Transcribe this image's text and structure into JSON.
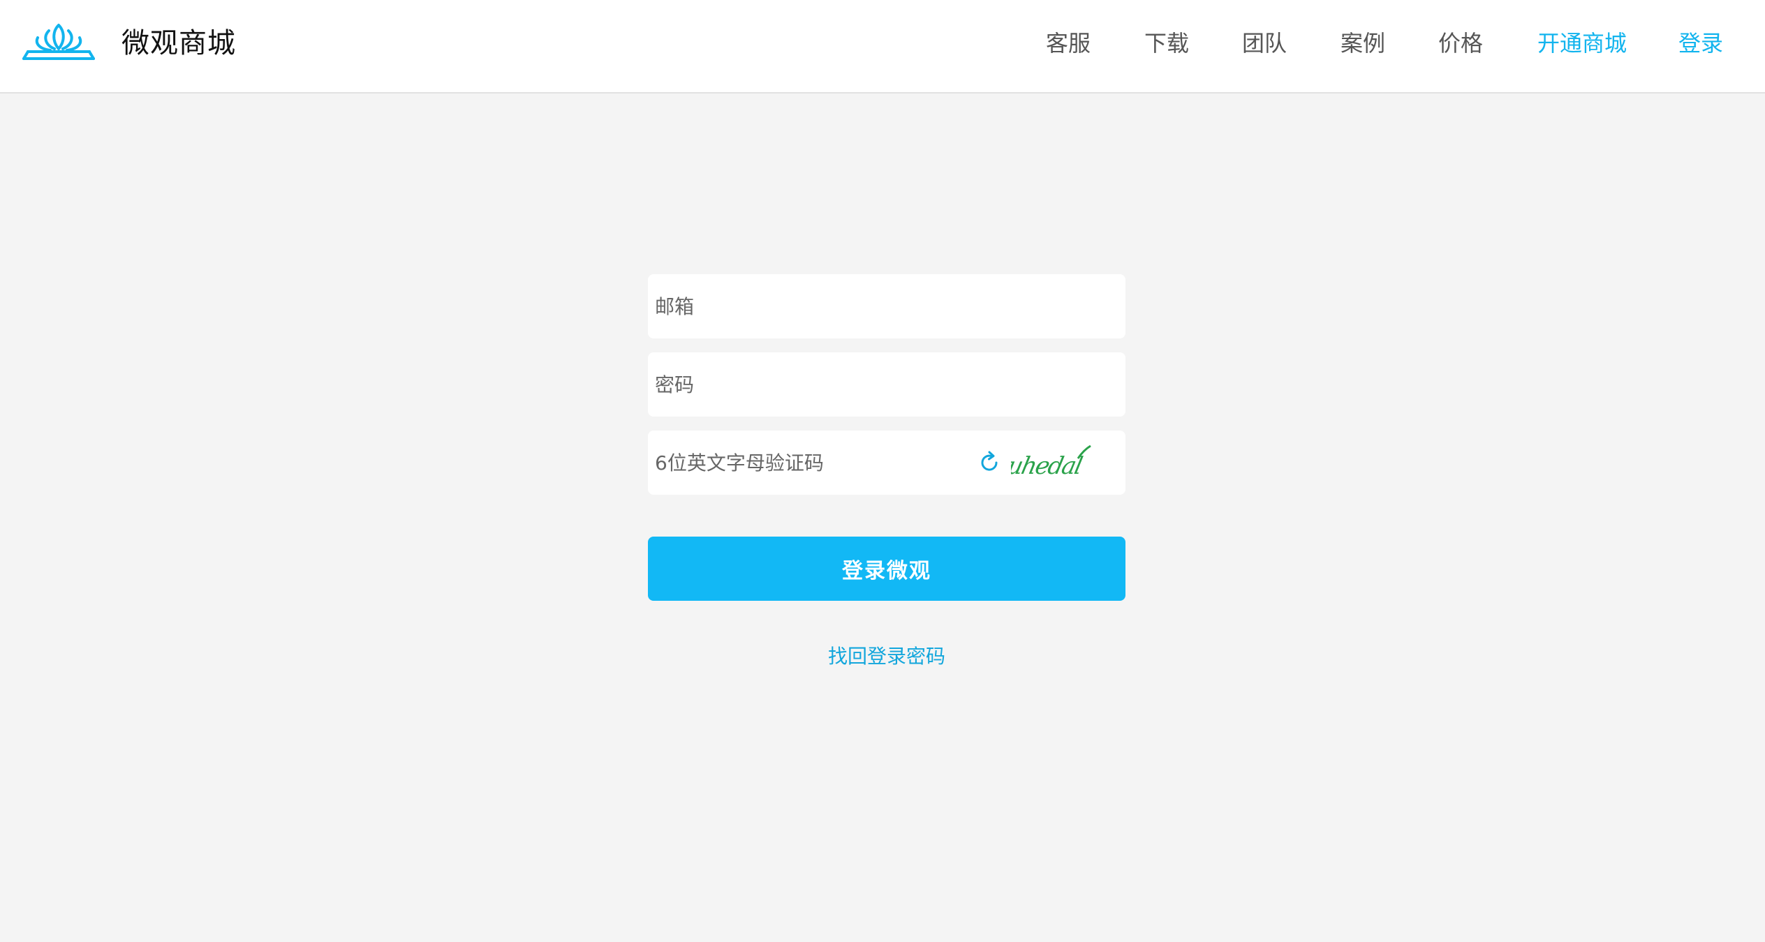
{
  "brand": {
    "name": "微观商城",
    "icon": "lotus-logo-icon",
    "color": "#12b4ee"
  },
  "nav": {
    "items": [
      {
        "label": "客服"
      },
      {
        "label": "下载"
      },
      {
        "label": "团队"
      },
      {
        "label": "案例"
      },
      {
        "label": "价格"
      },
      {
        "label": "开通商城"
      },
      {
        "label": "登录"
      }
    ]
  },
  "form": {
    "email_placeholder": "邮箱",
    "password_placeholder": "密码",
    "captcha_placeholder": "6位英文字母验证码",
    "captcha_text": "uhedal",
    "submit_label": "登录微观",
    "forgot_label": "找回登录密码",
    "accent_color": "#12b8f5"
  }
}
